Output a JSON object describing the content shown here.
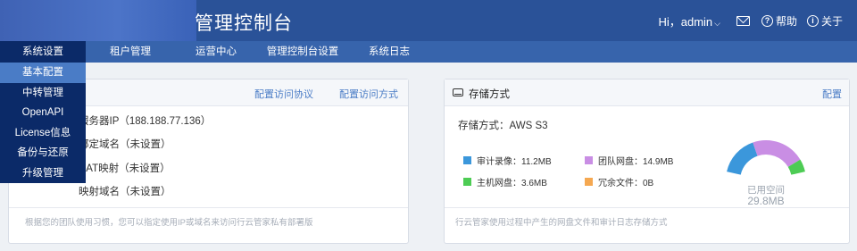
{
  "header": {
    "title": "管理控制台",
    "greeting": "Hi，admin",
    "help_label": "帮助",
    "about_label": "关于",
    "help_glyph": "?",
    "about_glyph": "i"
  },
  "nav": {
    "items": [
      {
        "label": "系统设置"
      },
      {
        "label": "租户管理"
      },
      {
        "label": "运营中心"
      },
      {
        "label": "管理控制台设置"
      },
      {
        "label": "系统日志"
      }
    ]
  },
  "dropdown": {
    "items": [
      {
        "label": "基本配置"
      },
      {
        "label": "中转管理"
      },
      {
        "label": "OpenAPI"
      },
      {
        "label": "License信息"
      },
      {
        "label": "备份与还原"
      },
      {
        "label": "升级管理"
      }
    ],
    "selected": "基本配置"
  },
  "access_card": {
    "link_protocol": "配置访问协议",
    "link_method": "配置访问方式",
    "rows": [
      "服务器IP（188.188.77.136）",
      "绑定域名（未设置）",
      "NAT映射（未设置）",
      "映射域名（未设置）"
    ],
    "footer": "根据您的团队使用习惯，您可以指定使用IP或域名来访问行云管家私有部署版"
  },
  "storage_card": {
    "title": "存储方式",
    "config_link": "配置",
    "storage_type": "存储方式：AWS S3",
    "legend": [
      {
        "label": "审计录像：11.2MB",
        "color": "#3b97db"
      },
      {
        "label": "团队网盘：14.9MB",
        "color": "#c98ee4"
      },
      {
        "label": "主机网盘：3.6MB",
        "color": "#4dcc54"
      },
      {
        "label": "冗余文件：0B",
        "color": "#f5a851"
      }
    ],
    "used_label": "已用空间",
    "used_value": "29.8MB",
    "footer": "行云管家使用过程中产生的网盘文件和审计日志存储方式",
    "chart_data": {
      "type": "pie",
      "categories": [
        "审计录像",
        "团队网盘",
        "主机网盘",
        "冗余文件"
      ],
      "values": [
        11.2,
        14.9,
        3.6,
        0
      ],
      "unit": "MB",
      "colors": [
        "#3b97db",
        "#c98ee4",
        "#4dcc54",
        "#f5a851"
      ]
    }
  }
}
